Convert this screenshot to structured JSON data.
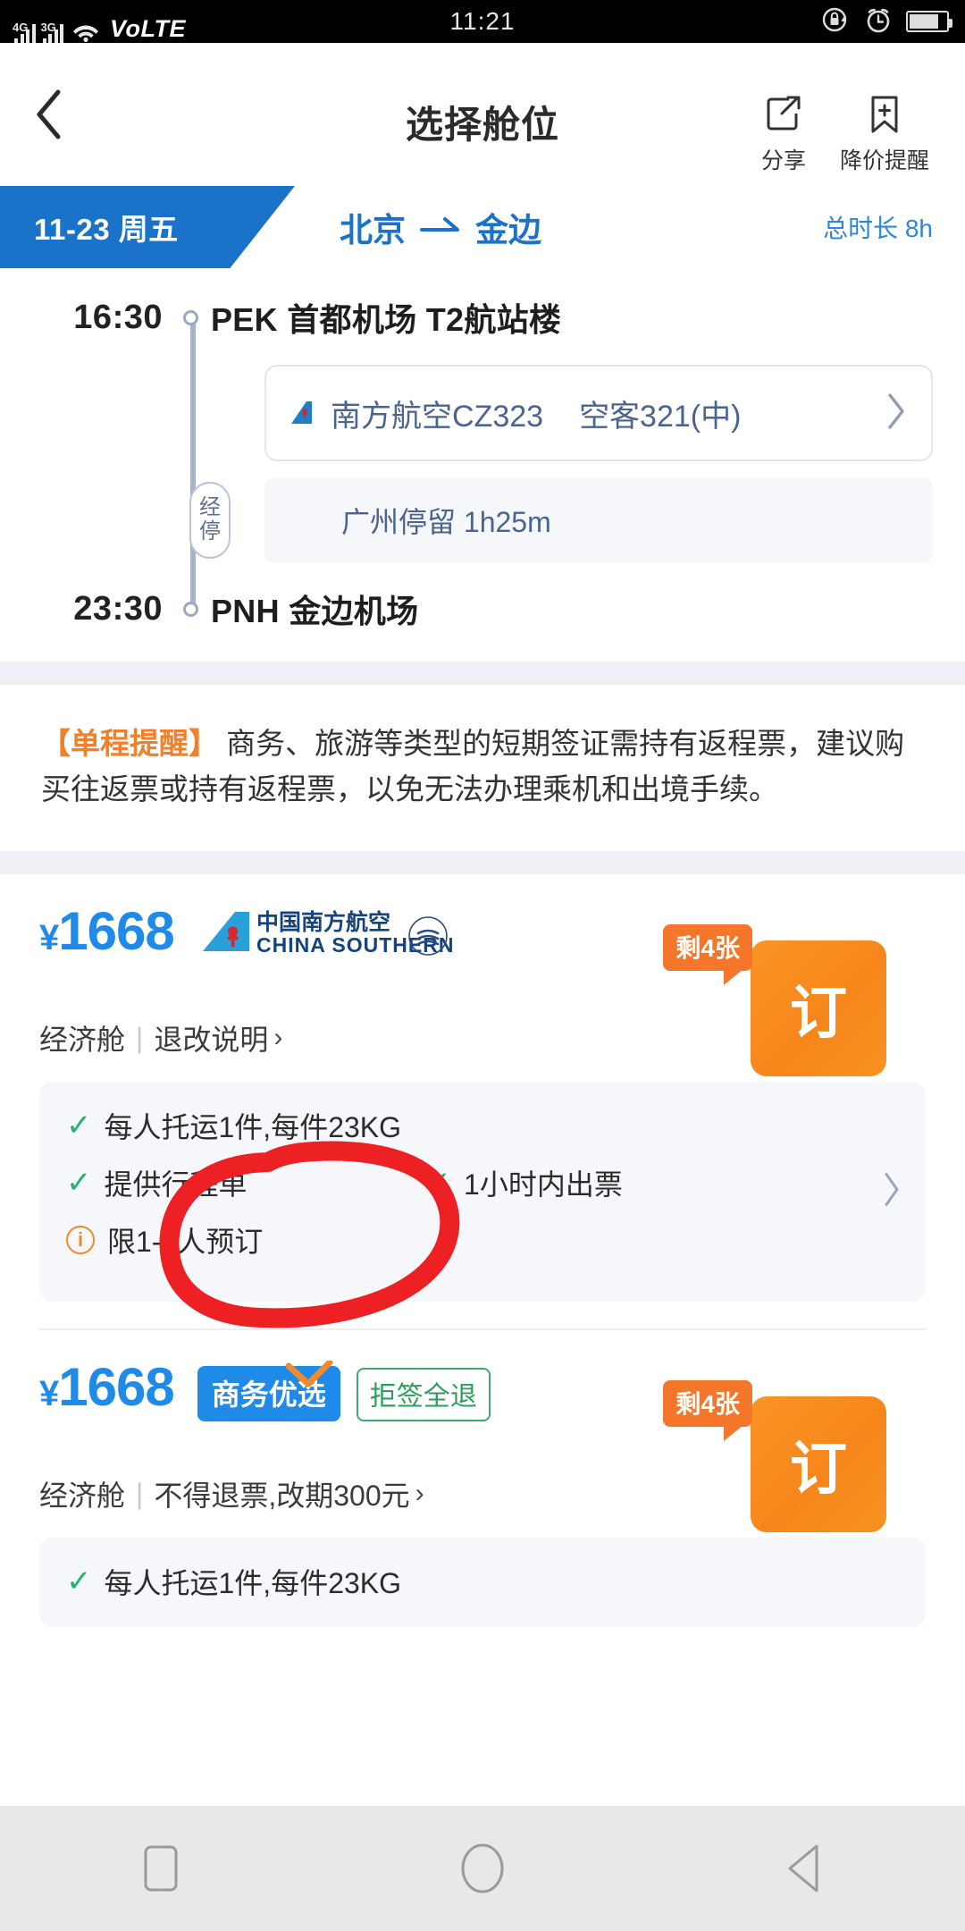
{
  "status_bar": {
    "net_label_1": "4G",
    "net_label_2": "3G",
    "volte": "VoLTE",
    "clock": "11:21",
    "icons": [
      "wifi-icon",
      "rotation-lock-icon",
      "alarm-clock-icon",
      "battery-icon"
    ]
  },
  "header": {
    "title": "选择舱位",
    "back_icon": "chevron-left-icon",
    "actions": [
      {
        "label": "分享",
        "icon": "share-icon"
      },
      {
        "label": "降价提醒",
        "icon": "price-alert-bookmark-icon"
      }
    ]
  },
  "route_banner": {
    "date": "11-23 周五",
    "from": "北京",
    "to": "金边",
    "arrow_icon": "arrow-right-icon",
    "duration_label": "总时长 8h",
    "accent_color": "#1a73c9"
  },
  "itinerary": {
    "depart": {
      "time": "16:30",
      "place": "PEK 首都机场 T2航站楼"
    },
    "arrive": {
      "time": "23:30",
      "place": "PNH 金边机场"
    },
    "flight": {
      "airline_flight": "南方航空CZ323",
      "aircraft": "空客321(中)",
      "tail_icon": "china-southern-tail-icon",
      "chevron_icon": "chevron-right-icon"
    },
    "stopover": {
      "tag_line1": "经",
      "tag_line2": "停",
      "text": "广州停留 1h25m"
    }
  },
  "notice": {
    "highlight": "【单程提醒】",
    "body": " 商务、旅游等类型的短期签证需持有返程票，建议购买往返票或持有返程票，以免无法办理乘机和出境手续。"
  },
  "fares": [
    {
      "currency": "¥",
      "price": "1668",
      "airline_logo_cn": "中国南方航空",
      "airline_logo_en": "CHINA SOUTHERN",
      "cabin": "经济舱",
      "policy_link": "退改说明",
      "policy_arrow": "›",
      "stock_badge": "剩4张",
      "order_button": "订",
      "amenities": [
        {
          "icon": "check-icon",
          "text": "每人托运1件,每件23KG"
        },
        {
          "icon": "check-icon",
          "text": "提供行程单"
        },
        {
          "icon": "check-icon",
          "text": "1小时内出票"
        },
        {
          "icon": "info-icon",
          "text": "限1-4人预订"
        }
      ],
      "amenities_chevron": "chevron-right-icon"
    },
    {
      "currency": "¥",
      "price": "1668",
      "badge_preferred": "商务优选",
      "badge_refund": "拒签全退",
      "cabin": "经济舱",
      "policy_link": "不得退票,改期300元",
      "policy_arrow": "›",
      "divider": "|",
      "stock_badge": "剩4张",
      "order_button": "订",
      "amenities": [
        {
          "icon": "check-icon",
          "text": "每人托运1件,每件23KG"
        }
      ]
    }
  ],
  "annotation": {
    "type": "hand-drawn-red-circle",
    "color": "#ed2024",
    "targets": "退改说明"
  },
  "nav_bar": {
    "items": [
      {
        "name": "recents-button",
        "icon": "square-icon"
      },
      {
        "name": "home-button",
        "icon": "circle-icon"
      },
      {
        "name": "back-button",
        "icon": "triangle-left-icon"
      }
    ]
  }
}
